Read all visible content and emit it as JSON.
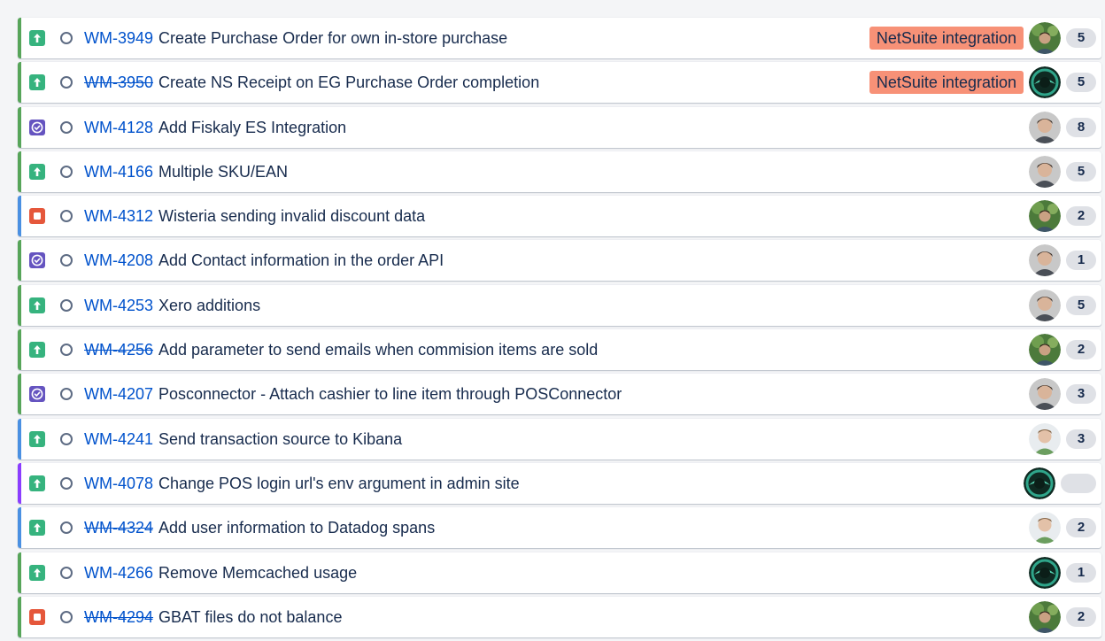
{
  "colors": {
    "story_green": "#36b37e",
    "bug_red": "#e5573b",
    "task_purple": "#6554c0",
    "key_blue": "#0052cc",
    "epic_label_bg": "#f79177",
    "epic_bar_green": "#57a55a",
    "epic_bar_blue": "#4a90e2",
    "epic_bar_purple": "#8b3dff"
  },
  "issues": [
    {
      "key": "WM-3949",
      "summary": "Create Purchase Order for own in-store purchase",
      "type": "story",
      "type_icon": "arrow-up-icon",
      "done": false,
      "epic": "NetSuite integration",
      "epic_bar": "#57a55a",
      "avatar": "avatar-outdoor",
      "estimate": "5"
    },
    {
      "key": "WM-3950",
      "summary": "Create NS Receipt on EG Purchase Order completion",
      "type": "story",
      "type_icon": "arrow-up-icon",
      "done": true,
      "epic": "NetSuite integration",
      "epic_bar": "#57a55a",
      "avatar": "avatar-teal",
      "estimate": "5"
    },
    {
      "key": "WM-4128",
      "summary": "Add Fiskaly ES Integration",
      "type": "task",
      "type_icon": "check-circle-icon",
      "done": false,
      "epic": "",
      "epic_bar": "#57a55a",
      "avatar": "avatar-man",
      "estimate": "8"
    },
    {
      "key": "WM-4166",
      "summary": "Multiple SKU/EAN",
      "type": "story",
      "type_icon": "arrow-up-icon",
      "done": false,
      "epic": "",
      "epic_bar": "#57a55a",
      "avatar": "avatar-man",
      "estimate": "5"
    },
    {
      "key": "WM-4312",
      "summary": "Wisteria sending invalid discount data",
      "type": "bug",
      "type_icon": "bug-icon",
      "done": false,
      "epic": "",
      "epic_bar": "#4a90e2",
      "avatar": "avatar-outdoor",
      "estimate": "2"
    },
    {
      "key": "WM-4208",
      "summary": "Add Contact information in the order API",
      "type": "task",
      "type_icon": "check-circle-icon",
      "done": false,
      "epic": "",
      "epic_bar": "#57a55a",
      "avatar": "avatar-man",
      "estimate": "1"
    },
    {
      "key": "WM-4253",
      "summary": "Xero additions",
      "type": "story",
      "type_icon": "arrow-up-icon",
      "done": false,
      "epic": "",
      "epic_bar": "#57a55a",
      "avatar": "avatar-man",
      "estimate": "5"
    },
    {
      "key": "WM-4256",
      "summary": "Add parameter to send emails when commision items are sold",
      "type": "story",
      "type_icon": "arrow-up-icon",
      "done": true,
      "epic": "",
      "epic_bar": "#57a55a",
      "avatar": "avatar-outdoor",
      "estimate": "2"
    },
    {
      "key": "WM-4207",
      "summary": "Posconnector - Attach cashier to line item through POSConnector",
      "type": "task",
      "type_icon": "check-circle-icon",
      "done": false,
      "epic": "",
      "epic_bar": "#57a55a",
      "avatar": "avatar-man",
      "estimate": "3"
    },
    {
      "key": "WM-4241",
      "summary": "Send transaction source to Kibana",
      "type": "story",
      "type_icon": "arrow-up-icon",
      "done": false,
      "epic": "",
      "epic_bar": "#4a90e2",
      "avatar": "avatar-light",
      "estimate": "3"
    },
    {
      "key": "WM-4078",
      "summary": "Change POS login url's env argument in admin site",
      "type": "story",
      "type_icon": "arrow-up-icon",
      "done": false,
      "epic": "",
      "epic_bar": "#8b3dff",
      "avatar": "avatar-teal",
      "estimate": ""
    },
    {
      "key": "WM-4324",
      "summary": "Add user information to Datadog spans",
      "type": "story",
      "type_icon": "arrow-up-icon",
      "done": true,
      "epic": "",
      "epic_bar": "#4a90e2",
      "avatar": "avatar-light",
      "estimate": "2"
    },
    {
      "key": "WM-4266",
      "summary": "Remove Memcached usage",
      "type": "story",
      "type_icon": "arrow-up-icon",
      "done": false,
      "epic": "",
      "epic_bar": "#57a55a",
      "avatar": "avatar-teal",
      "estimate": "1"
    },
    {
      "key": "WM-4294",
      "summary": "GBAT files do not balance",
      "type": "bug",
      "type_icon": "bug-icon",
      "done": true,
      "epic": "",
      "epic_bar": "#57a55a",
      "avatar": "avatar-outdoor",
      "estimate": "2"
    }
  ]
}
